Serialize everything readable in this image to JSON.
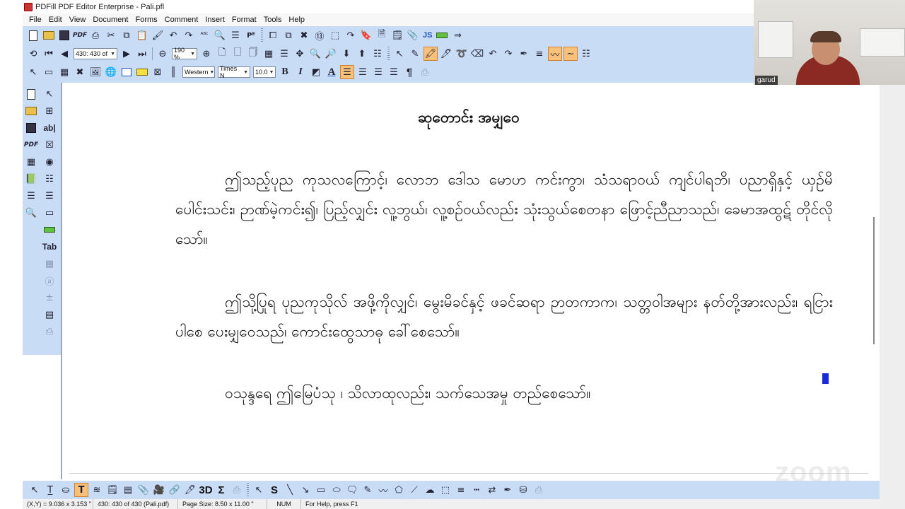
{
  "window": {
    "title": "PDFill PDF Editor Enterprise - Pali.pfl"
  },
  "menu": {
    "items": [
      "File",
      "Edit",
      "View",
      "Document",
      "Forms",
      "Comment",
      "Insert",
      "Format",
      "Tools",
      "Help"
    ]
  },
  "toolbar": {
    "page_select": "430: 430 of",
    "zoom_select": "190 %",
    "js_label": "JS",
    "pdf_label": "PDF",
    "encoding_select": "Western",
    "font_select": "Times N",
    "size_select": "10.0",
    "bold_label": "B",
    "italic_label": "I",
    "color_label": "A",
    "pilcrow_label": "¶"
  },
  "left_toolbar": {
    "pdf_label": "PDF",
    "abl_label": "ab|",
    "tab_label": "Tab"
  },
  "document": {
    "heading": "ဆုတောင်း အမျှဝေ",
    "paragraphs": [
      "ဤသည့်ပုည ကုသလကြောင့်၊ လောဘ ဒေါသ မောဟ ကင်းကွာ၊ သံသရာဝယ် ကျင်ပါရဘိ၊ ပညာရှိနှင့် ယှဉ်မိပေါင်းသင်း၊ ဉာဏ်မဲ့ကင်း၍၊ ပြည့်လျှင်း လူ့ဘွယ်၊ လူ့စဉ်ဝယ်လည်း သုံးသွယ်စေတနာ ဖြောင့်ညီညာသည်၊ ခေမာအထွဋ် တိုင်လိုသော်။",
      "ဤသို့ပြုရ ပုညကုသိုလ် အဖို့ကိုလျှင်၊ မွေးမိခင်နှင့် ဖခင်ဆရာ ဉာတကာက၊ သတ္တဝါအများ နတ်တို့အားလည်း၊ ရငြားပါစေ ပေးမျှဝေသည်၊ ကောင်းထွေသာဓု ခေါ်စေသော်။",
      "ဝသုန္ဒရေ ဤမြေပံသု ၊ သိလာထုလည်း၊ သက်သေအမှု တည်စေသော်။"
    ]
  },
  "bottom_toolbar": {
    "s_label": "S",
    "three_d_label": "3D",
    "sigma_label": "Σ"
  },
  "statusbar": {
    "coords": "(X,Y) = 9.036 x 3.153 \"",
    "page_info": "430: 430 of 430 (Pali.pdf)",
    "page_size": "Page Size: 8.50 x 11.00 \"",
    "num": "NUM",
    "help": "For Help, press F1"
  },
  "webcam": {
    "name": "garud"
  },
  "watermark": {
    "text": "zoom"
  },
  "colors": {
    "toolbar_bg": "#c8dcf5",
    "caret": "#1a2ad8",
    "highlight": "#f7c17a"
  }
}
